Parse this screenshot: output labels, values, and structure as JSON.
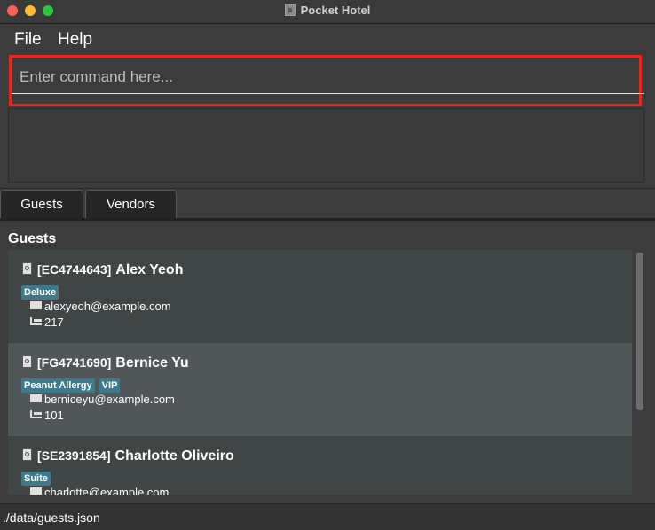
{
  "window": {
    "title": "Pocket Hotel"
  },
  "menu": {
    "file": "File",
    "help": "Help"
  },
  "command": {
    "placeholder": "Enter command here...",
    "value": ""
  },
  "tabs": [
    {
      "label": "Guests"
    },
    {
      "label": "Vendors"
    }
  ],
  "guests": {
    "title": "Guests",
    "items": [
      {
        "id": "[EC4744643]",
        "name": "Alex Yeoh",
        "tags": [
          "Deluxe"
        ],
        "email": "alexyeoh@example.com",
        "room": "217"
      },
      {
        "id": "[FG4741690]",
        "name": "Bernice Yu",
        "tags": [
          "Peanut Allergy",
          "VIP"
        ],
        "email": "berniceyu@example.com",
        "room": "101"
      },
      {
        "id": "[SE2391854]",
        "name": "Charlotte Oliveiro",
        "tags": [
          "Suite"
        ],
        "email": "charlotte@example.com",
        "room": ""
      }
    ]
  },
  "status": {
    "file_path": "./data/guests.json"
  },
  "colors": {
    "highlight": "#e8261b",
    "tag": "#3f7a8c",
    "selected_row": "#515658"
  }
}
